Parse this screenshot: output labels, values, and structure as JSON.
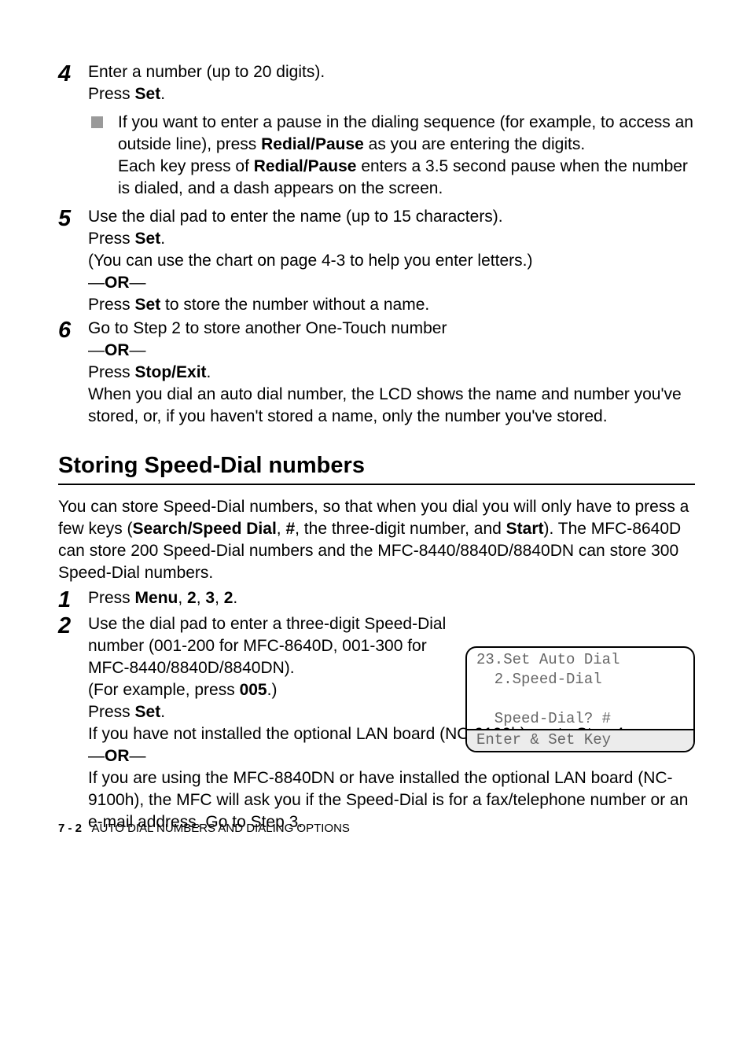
{
  "step4": {
    "num": "4",
    "line1a": "Enter a number (up to 20 digits).",
    "line2a": "Press ",
    "line2b": "Set",
    "line2c": ".",
    "bullet": {
      "a": "If you want to enter a pause in the dialing sequence (for example, to access an outside line), press ",
      "b": "Redial/Pause",
      "c": " as you are entering the digits.",
      "d": "Each key press of ",
      "e": "Redial/Pause",
      "f": " enters a 3.5 second pause when the number is dialed, and a dash appears on the screen."
    }
  },
  "step5": {
    "num": "5",
    "a": "Use the dial pad to enter the name (up to 15 characters).",
    "b1": "Press ",
    "b2": "Set",
    "b3": ".",
    "c": "(You can use the chart on ",
    "c_ref": "page 4-3",
    "c2": " to help you enter letters.)",
    "or1a": "—",
    "or1b": "OR",
    "or1c": "—",
    "d1": "Press ",
    "d2": "Set",
    "d3": " to store the number without a name."
  },
  "step6": {
    "num": "6",
    "a": "Go to Step 2 to store another One-Touch number",
    "or1a": "—",
    "or1b": "OR",
    "or1c": "—",
    "b1": "Press ",
    "b2": "Stop/Exit",
    "b3": ".",
    "c": "When you dial an auto dial number, the LCD shows the name and number you've stored, or, if you haven't stored a name, only the number you've stored."
  },
  "section": {
    "title": "Storing Speed-Dial numbers",
    "intro1": "You can store Speed-Dial numbers, so that when you dial you will only have to press a few keys (",
    "intro2": "Search/Speed Dial",
    "intro3": ", ",
    "intro4": "#",
    "intro5": ", the three-digit number, and ",
    "intro6": "Start",
    "intro7": "). The MFC-8640D can store 200 Speed-Dial numbers and the MFC-8440/8840D/8840DN can store 300 Speed-Dial numbers."
  },
  "sd_step1": {
    "num": "1",
    "a": "Press ",
    "b": "Menu",
    "c": ", ",
    "d": "2",
    "e": ", ",
    "f": "3",
    "g": ", ",
    "h": "2",
    "i": "."
  },
  "sd_step2": {
    "num": "2",
    "a": "Use the dial pad to enter a three-digit Speed-Dial number (001-200 for MFC-8640D, 001-300 for MFC-8440/8840D/8840DN).",
    "b1": "(For example, press ",
    "b2": "005",
    "b3": ".)",
    "c1": "Press ",
    "c2": "Set",
    "c3": ".",
    "d": "If you have not installed the optional LAN board (NC-9100h), go to Step 4.",
    "or1a": "—",
    "or1b": "OR",
    "or1c": "—",
    "e": "If you are using the MFC-8840DN or have installed the optional LAN board (NC-9100h), the MFC will ask you if the Speed-Dial is for a fax/telephone number or an e-mail address. Go to Step 3."
  },
  "lcd": {
    "l1": "23.Set Auto Dial",
    "l2": "  2.Speed-Dial",
    "l3": " ",
    "l4": "  Speed-Dial? #",
    "l5": "Enter & Set Key"
  },
  "footer": {
    "page": "7 - 2",
    "title": "AUTO DIAL NUMBERS AND DIALING OPTIONS"
  }
}
